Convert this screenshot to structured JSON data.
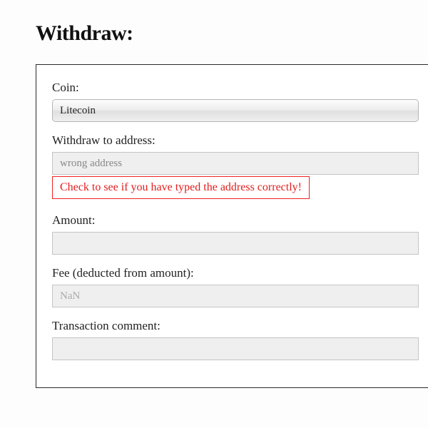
{
  "heading": "Withdraw:",
  "form": {
    "coin": {
      "label": "Coin:",
      "selected": "Litecoin"
    },
    "address": {
      "label": "Withdraw to address:",
      "value": "wrong address",
      "error": "Check to see if you have typed the address correctly!"
    },
    "amount": {
      "label": "Amount:",
      "value": ""
    },
    "fee": {
      "label": "Fee (deducted from amount):",
      "value": "NaN"
    },
    "comment": {
      "label": "Transaction comment:",
      "value": ""
    }
  }
}
